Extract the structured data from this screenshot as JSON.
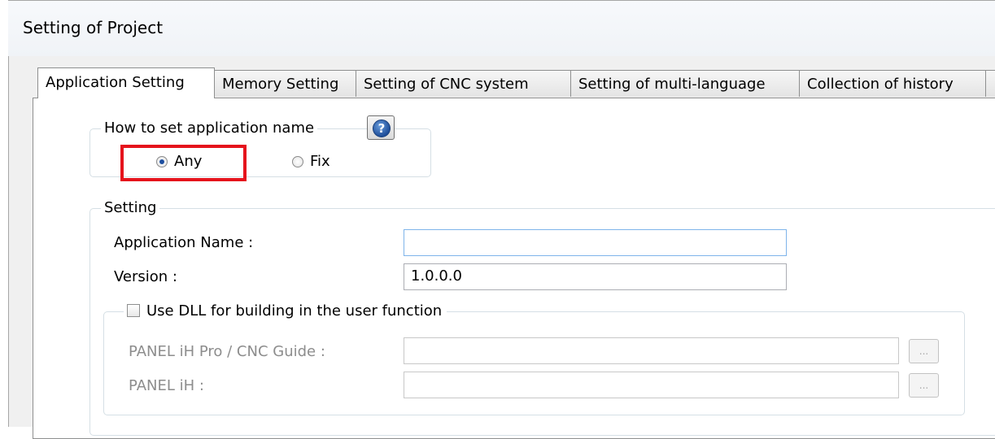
{
  "window": {
    "title": "Setting of Project"
  },
  "tabs": [
    {
      "label": "Application Setting",
      "active": true
    },
    {
      "label": "Memory Setting",
      "active": false
    },
    {
      "label": "Setting of CNC system",
      "active": false
    },
    {
      "label": "Setting of multi-language",
      "active": false
    },
    {
      "label": "Collection of history",
      "active": false
    }
  ],
  "name_mode_group": {
    "legend": "How to set application name",
    "help_icon": "question-circle",
    "options": [
      {
        "label": "Any",
        "selected": true
      },
      {
        "label": "Fix",
        "selected": false
      }
    ],
    "highlight_color": "#e5131c"
  },
  "setting_group": {
    "legend": "Setting",
    "app_name_label": "Application Name :",
    "app_name_value": "",
    "version_label": "Version :",
    "version_value": "1.0.0.0",
    "dll": {
      "checkbox_label": "Use DLL for building in the user function",
      "checked": false,
      "panel_pro_label": "PANEL iH Pro / CNC Guide :",
      "panel_pro_value": "",
      "panel_ih_label": "PANEL iH :",
      "panel_ih_value": "",
      "browse_label": "..."
    }
  }
}
